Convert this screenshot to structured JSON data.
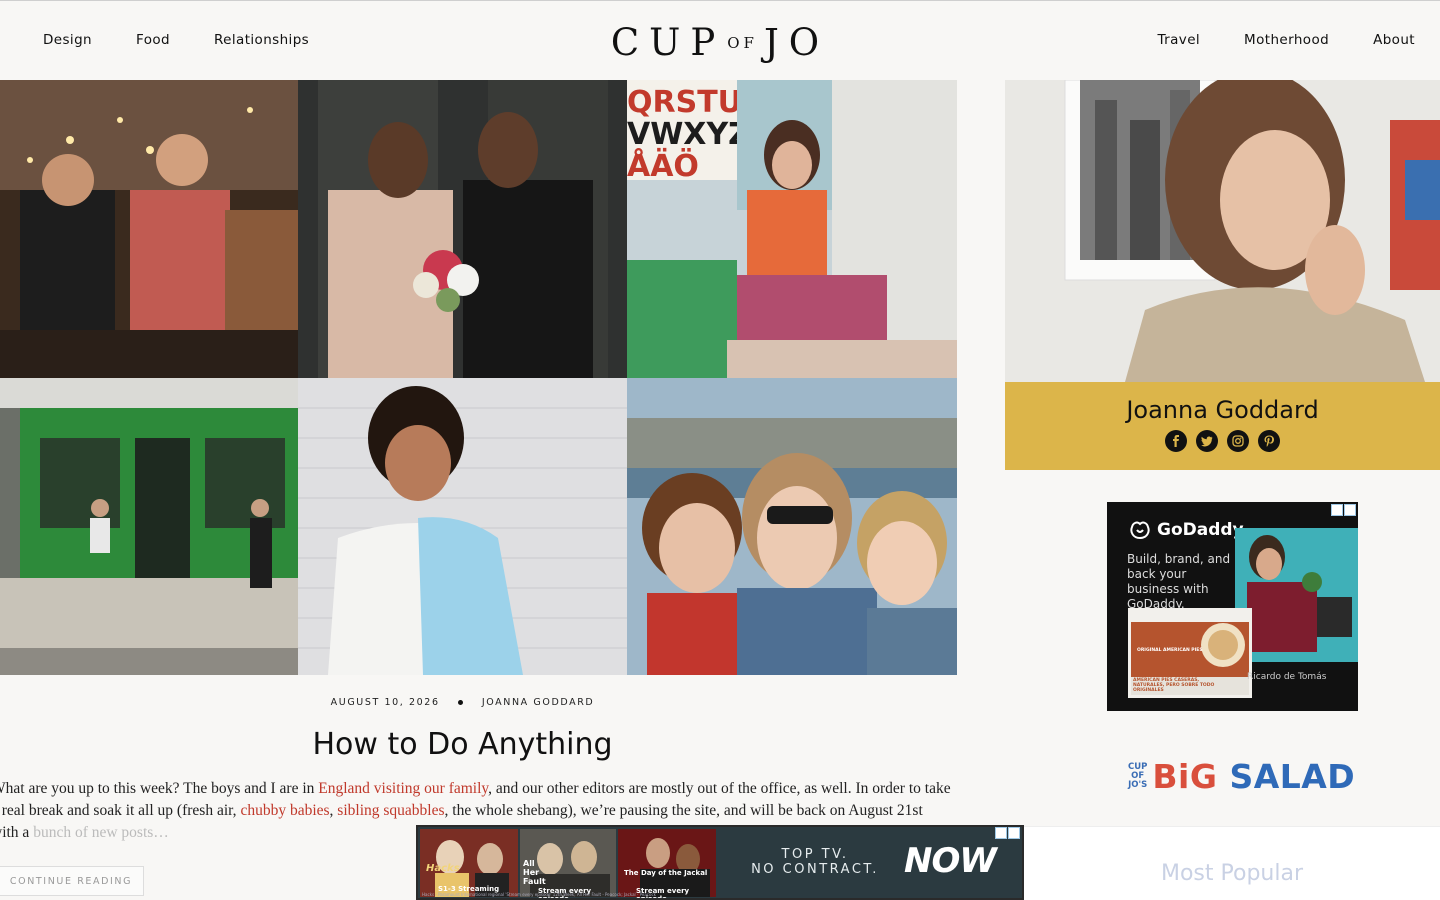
{
  "nav": {
    "left": [
      "Design",
      "Food",
      "Relationships"
    ],
    "right": [
      "Travel",
      "Motherhood",
      "About"
    ],
    "logo": {
      "part1": "CUP",
      "part2": "OF",
      "part3": "JO"
    }
  },
  "grid_tiles": [
    {
      "name": "party-dance-photo",
      "text": ""
    },
    {
      "name": "wedding-couple-photo",
      "text": ""
    },
    {
      "name": "woman-with-alphabet-poster-photo",
      "text": "QRSTU\nVWXYZ\nÅÄÖ"
    },
    {
      "name": "green-cafe-storefront-photo",
      "text": ""
    },
    {
      "name": "laughing-woman-blue-dress-photo",
      "text": ""
    },
    {
      "name": "family-selfie-photo",
      "text": ""
    }
  ],
  "post": {
    "date": "AUGUST 10, 2026",
    "author": "JOANNA GODDARD",
    "title": "How to Do Anything",
    "excerpt": {
      "t1": "What are you up to this week? The boys and I are in ",
      "l1": "England visiting our family",
      "t2": ", and our other editors are mostly out of the office, as well. In order to take a real break and soak it all up (fresh air, ",
      "l2": "chubby babies",
      "t3": ", ",
      "l3": "sibling squabbles",
      "t4": ", the whole shebang), we’re pausing the site, and will be back on August 21st with a ",
      "t5": "bunch of new posts…"
    },
    "continue_label": "CONTINUE READING"
  },
  "sidebar": {
    "profile_name": "Joanna Goddard",
    "socials": [
      "facebook-icon",
      "twitter-icon",
      "instagram-icon",
      "pinterest-icon"
    ],
    "ad": {
      "brand": "GoDaddy",
      "copy": "Build, brand, and back your business with GoDaddy.",
      "credit": "Ricardo de Tomás",
      "mock_title": "ORIGINAL AMERICAN PIES",
      "mock_sub": "AMERICAN PIES CASERAS, NATURALES, PERO SOBRE TODO ORIGINALES"
    },
    "big_salad": {
      "small": [
        "CUP",
        "OF",
        "JO'S"
      ],
      "big1": "BiG",
      "big2": "SALAD"
    },
    "most_popular": "Most Popular"
  },
  "bottom_ad": {
    "panels": [
      "Hacks",
      "All Her Fault",
      "The Day of the Jackal"
    ],
    "tags": [
      "S1-3 Streaming",
      "Stream every episode",
      "Stream every episode"
    ],
    "copy_line1": "TOP TV.",
    "copy_line2": "NO CONTRACT.",
    "brand": "NOW",
    "legal": "Hacks - Paramount International regional 'Stream every episode' 12th Week; All Her Fault - Peacock; Jackal - Peacock"
  },
  "colors": {
    "accent_link": "#c0392b",
    "profile_band": "#dcb54a",
    "bigsalad_red": "#d94f3c",
    "bigsalad_blue": "#2f6ab8"
  }
}
